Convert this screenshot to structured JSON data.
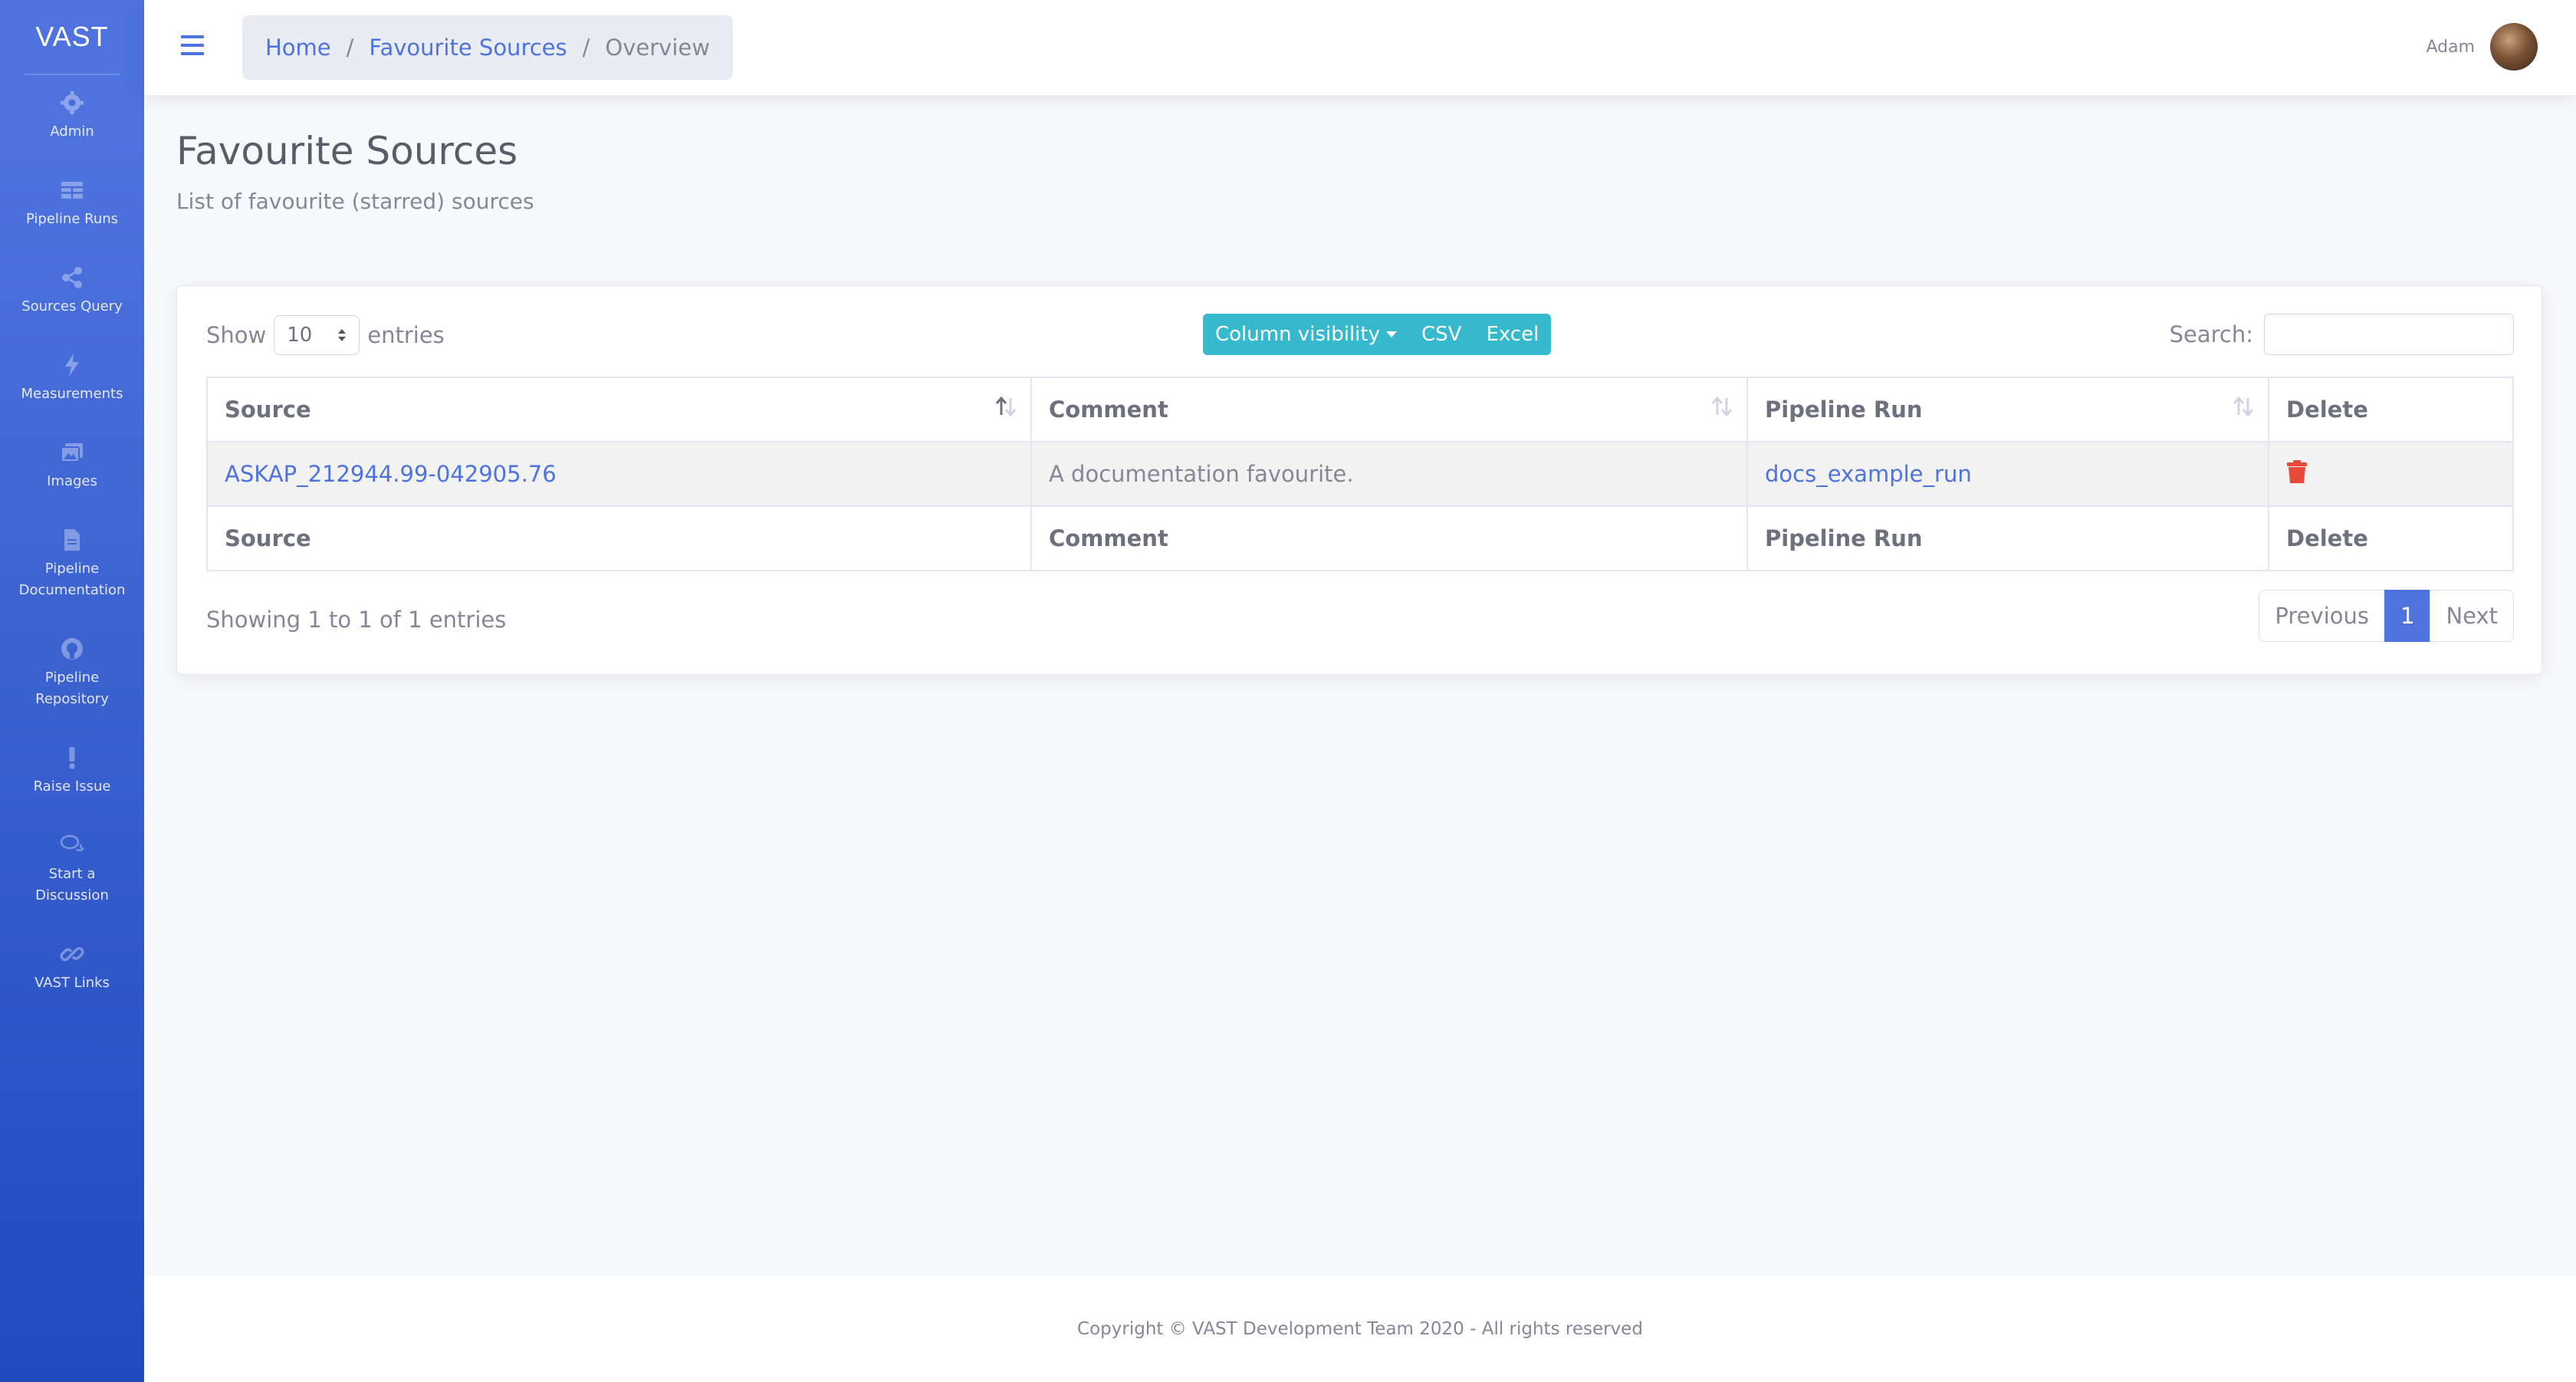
{
  "sidebar": {
    "brand": "VAST",
    "items": [
      {
        "label": "Admin",
        "icon": "gear-icon"
      },
      {
        "label": "Pipeline Runs",
        "icon": "table-icon"
      },
      {
        "label": "Sources Query",
        "icon": "share-icon"
      },
      {
        "label": "Measurements",
        "icon": "bolt-icon"
      },
      {
        "label": "Images",
        "icon": "images-icon"
      },
      {
        "label": "Pipeline Documentation",
        "icon": "file-icon"
      },
      {
        "label": "Pipeline Repository",
        "icon": "github-icon"
      },
      {
        "label": "Raise Issue",
        "icon": "exclamation-icon"
      },
      {
        "label": "Start a Discussion",
        "icon": "comments-icon"
      },
      {
        "label": "VAST Links",
        "icon": "link-icon"
      }
    ]
  },
  "topbar": {
    "breadcrumb": {
      "home": "Home",
      "section": "Favourite Sources",
      "current": "Overview",
      "separator": "/"
    },
    "user_name": "Adam"
  },
  "main": {
    "title": "Favourite Sources",
    "subtitle": "List of favourite (starred) sources"
  },
  "table": {
    "length": {
      "show": "Show",
      "value": "10",
      "entries": "entries"
    },
    "buttons": {
      "column_visibility": "Column visibility",
      "csv": "CSV",
      "excel": "Excel"
    },
    "search_label": "Search:",
    "search_value": "",
    "columns": [
      "Source",
      "Comment",
      "Pipeline Run",
      "Delete"
    ],
    "rows": [
      {
        "source": "ASKAP_212944.99-042905.76",
        "comment": "A documentation favourite.",
        "pipeline_run": "docs_example_run"
      }
    ],
    "info": "Showing 1 to 1 of 1 entries",
    "pagination": {
      "previous": "Previous",
      "current": "1",
      "next": "Next"
    }
  },
  "footer": "Copyright © VAST Development Team 2020 - All rights reserved",
  "colors": {
    "primary": "#4e73df",
    "info": "#36b9cc",
    "danger": "#e74a3b"
  }
}
